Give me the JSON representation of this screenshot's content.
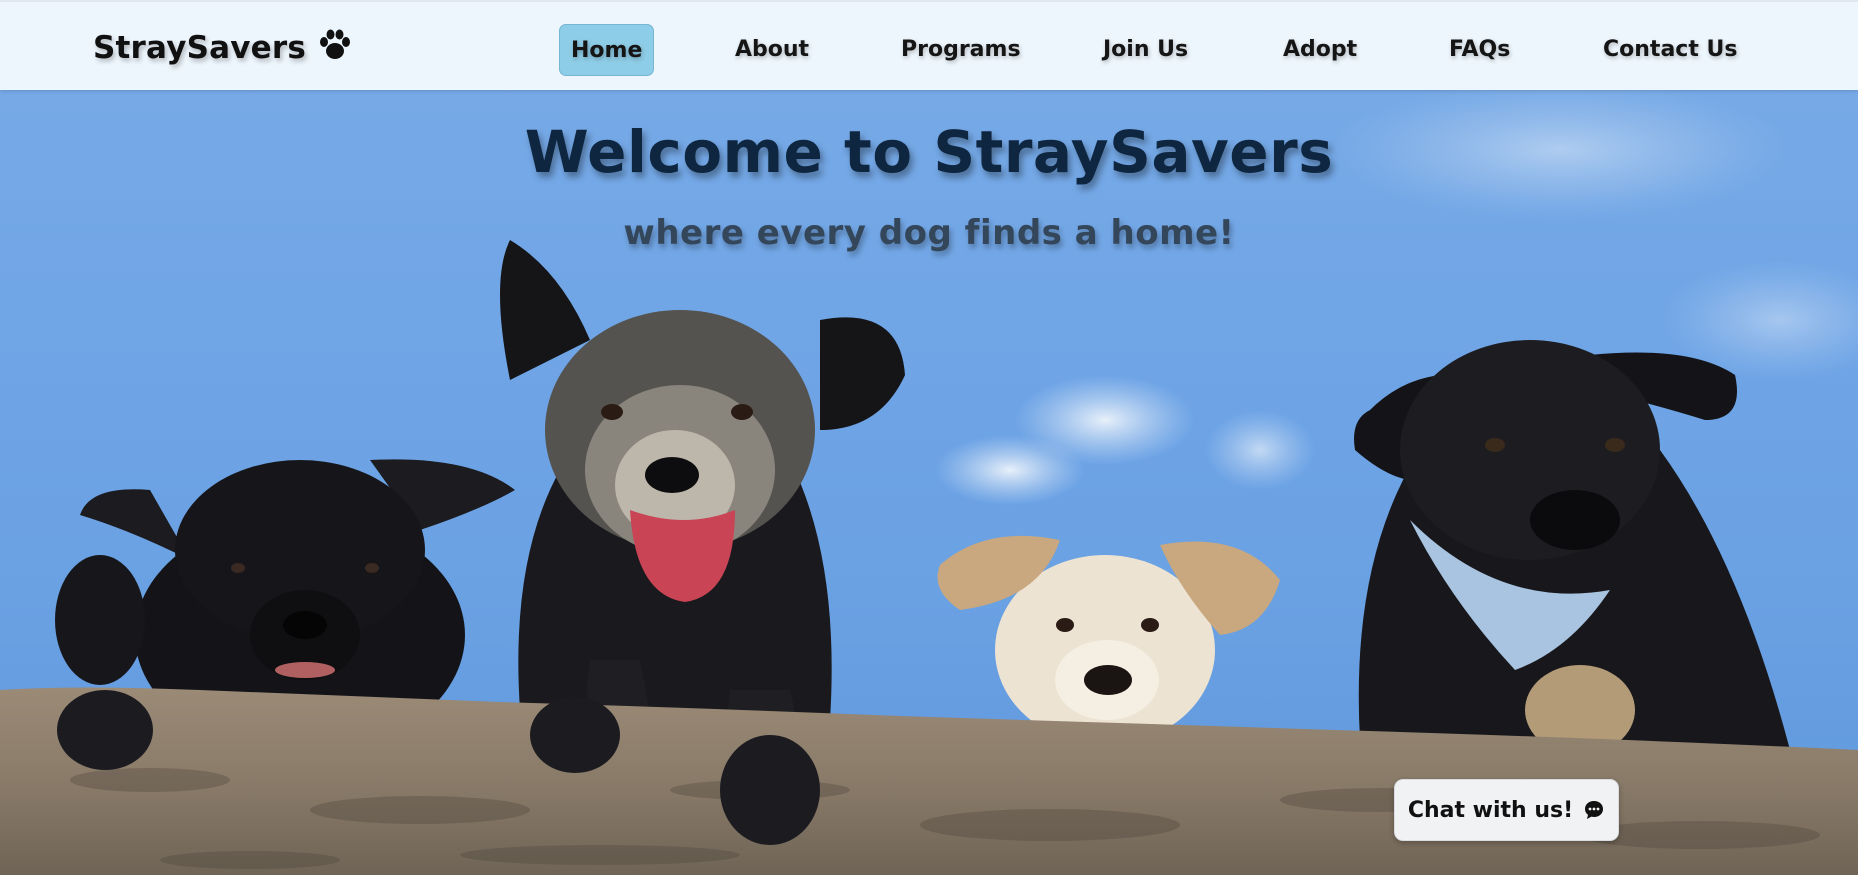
{
  "brand": {
    "name": "StraySavers",
    "icon": "paw-icon"
  },
  "nav": {
    "items": [
      {
        "label": "Home",
        "active": true
      },
      {
        "label": "About",
        "active": false
      },
      {
        "label": "Programs",
        "active": false
      },
      {
        "label": "Join Us",
        "active": false
      },
      {
        "label": "Adopt",
        "active": false
      },
      {
        "label": "FAQs",
        "active": false
      },
      {
        "label": "Contact Us",
        "active": false
      }
    ]
  },
  "hero": {
    "title": "Welcome to StraySavers",
    "subtitle": "where every dog finds a home!"
  },
  "chat": {
    "label": "Chat with us!",
    "icon": "chat-bubble-icon"
  },
  "colors": {
    "navbar_bg": "#eef6fd",
    "active_tab_bg": "#8ecde7",
    "sky": "#6fa6e6",
    "hero_title": "#0e2640",
    "hero_subtitle": "#34465a"
  }
}
